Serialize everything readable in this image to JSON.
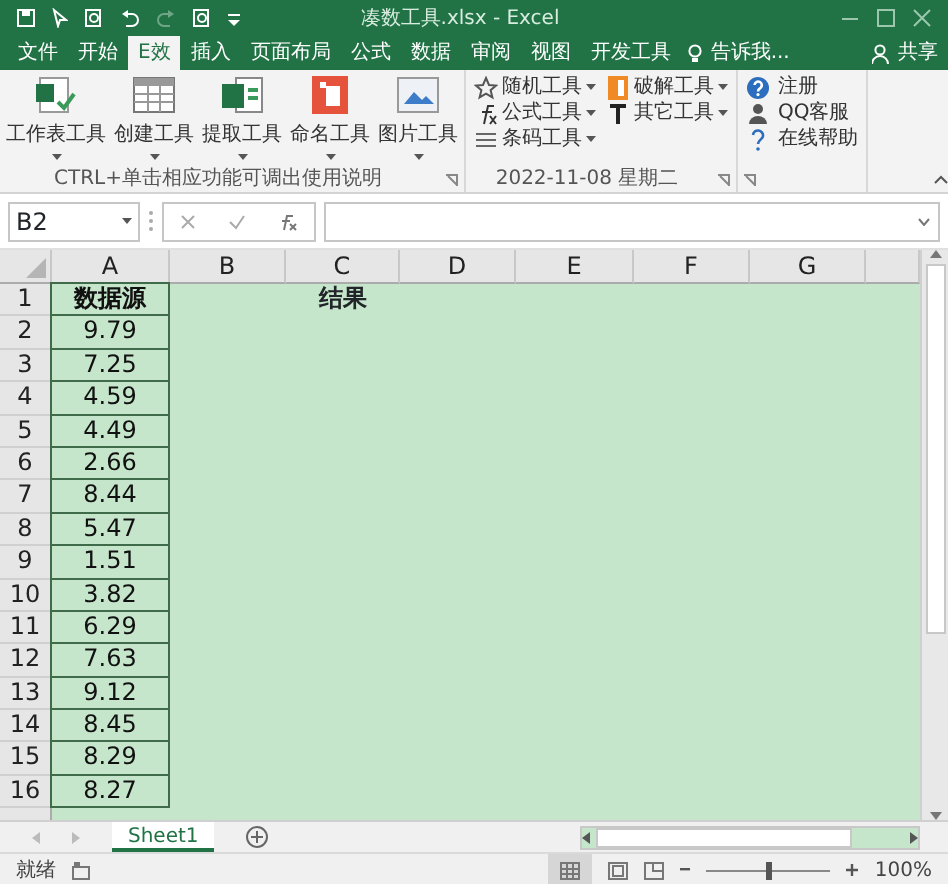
{
  "window": {
    "title": "凑数工具.xlsx - Excel"
  },
  "tabs": [
    {
      "label": "文件",
      "selected": false
    },
    {
      "label": "开始",
      "selected": false
    },
    {
      "label": "E效",
      "selected": true
    },
    {
      "label": "插入",
      "selected": false
    },
    {
      "label": "页面布局",
      "selected": false
    },
    {
      "label": "公式",
      "selected": false
    },
    {
      "label": "数据",
      "selected": false
    },
    {
      "label": "审阅",
      "selected": false
    },
    {
      "label": "视图",
      "selected": false
    },
    {
      "label": "开发工具",
      "selected": false
    }
  ],
  "tell_me": "告诉我...",
  "share": "共享",
  "ribbon": {
    "groups": [
      {
        "kind": "large",
        "label": "CTRL+单击相应功能可调出使用说明",
        "items": [
          {
            "label": "工作表工具"
          },
          {
            "label": "创建工具"
          },
          {
            "label": "提取工具"
          },
          {
            "label": "命名工具"
          },
          {
            "label": "图片工具"
          }
        ]
      },
      {
        "kind": "small",
        "label": "2022-11-08 星期二",
        "items": [
          {
            "label": "随机工具"
          },
          {
            "label": "破解工具"
          },
          {
            "label": "公式工具"
          },
          {
            "label": "其它工具"
          },
          {
            "label": "条码工具"
          }
        ]
      },
      {
        "kind": "links",
        "items": [
          {
            "label": "注册"
          },
          {
            "label": "QQ客服"
          },
          {
            "label": "在线帮助"
          }
        ]
      }
    ]
  },
  "name_box": "B2",
  "columns": [
    "A",
    "B",
    "C",
    "D",
    "E",
    "F",
    "G"
  ],
  "rows": [
    {
      "number": "1",
      "a": "数据源",
      "c": "结果"
    },
    {
      "number": "2",
      "a": "9.79"
    },
    {
      "number": "3",
      "a": "7.25"
    },
    {
      "number": "4",
      "a": "4.59"
    },
    {
      "number": "5",
      "a": "4.49"
    },
    {
      "number": "6",
      "a": "2.66"
    },
    {
      "number": "7",
      "a": "8.44"
    },
    {
      "number": "8",
      "a": "5.47"
    },
    {
      "number": "9",
      "a": "1.51"
    },
    {
      "number": "10",
      "a": "3.82"
    },
    {
      "number": "11",
      "a": "6.29"
    },
    {
      "number": "12",
      "a": "7.63"
    },
    {
      "number": "13",
      "a": "9.12"
    },
    {
      "number": "14",
      "a": "8.45"
    },
    {
      "number": "15",
      "a": "8.29"
    },
    {
      "number": "16",
      "a": "8.27"
    }
  ],
  "sheets": [
    {
      "label": "Sheet1",
      "selected": true
    }
  ],
  "status": {
    "text": "就绪",
    "zoom": "100%",
    "level": 0.5
  }
}
